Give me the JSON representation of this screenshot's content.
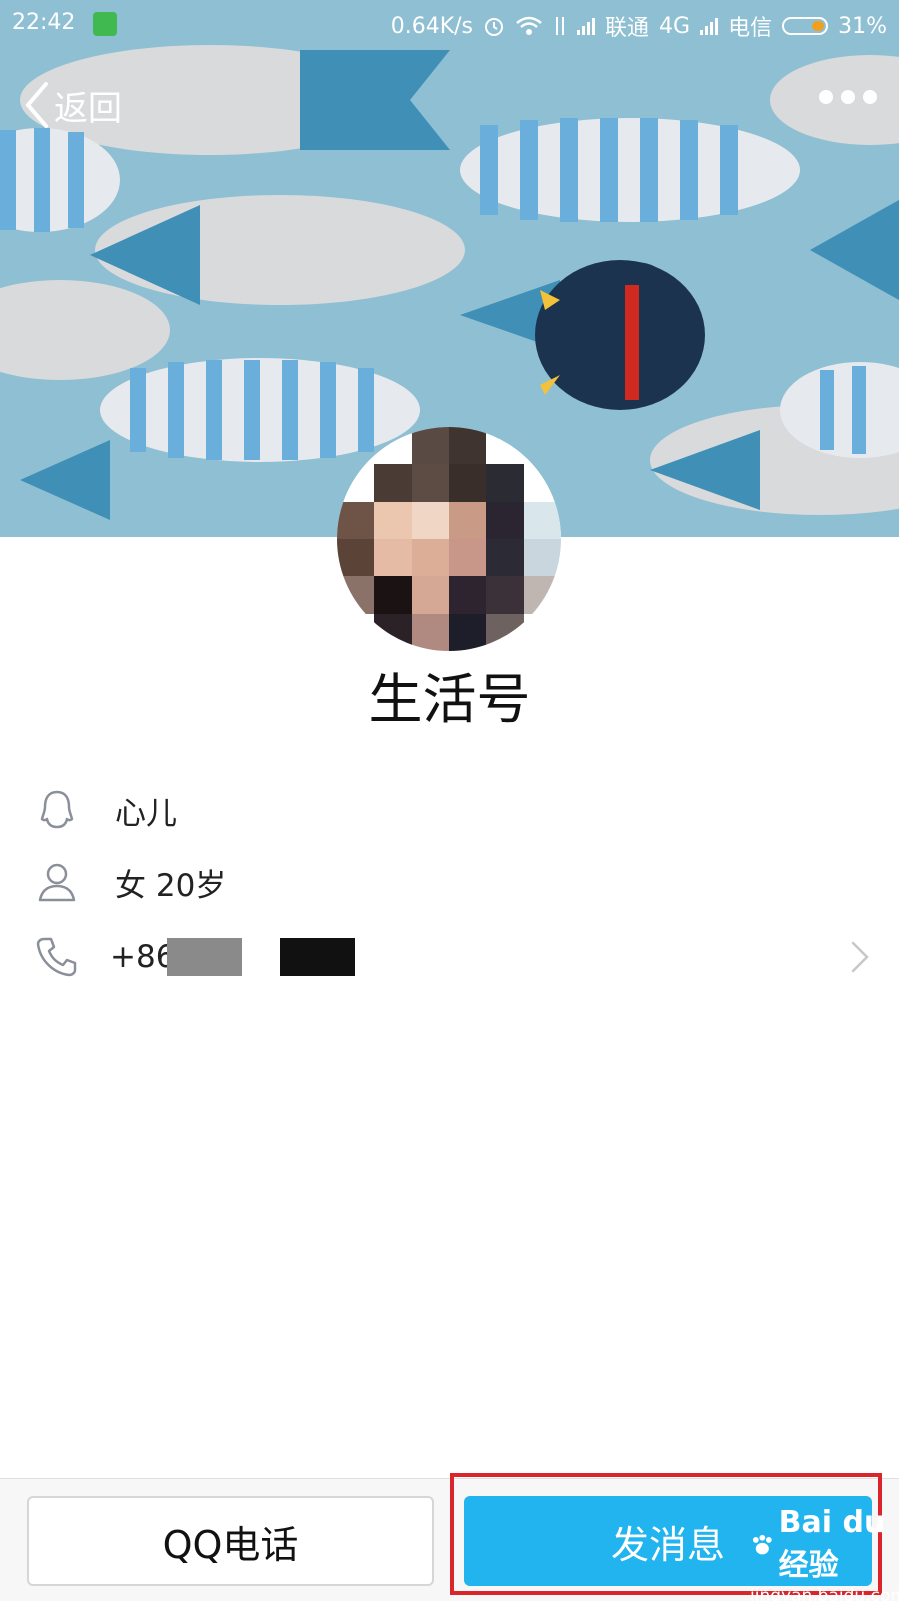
{
  "status_bar": {
    "time": "22:42",
    "net_speed": "0.64K/s",
    "carrier1": "联通",
    "network_type": "4G",
    "carrier2": "电信",
    "battery": "31%"
  },
  "nav": {
    "back_label": "返回"
  },
  "profile": {
    "name": "生活号",
    "nickname": "心儿",
    "gender_age": "女  20岁",
    "phone_prefix": "+86"
  },
  "actions": {
    "call_label": "QQ电话",
    "message_label": "发消息"
  },
  "watermark": {
    "brand": "Bai du 经验",
    "url": "jingyan.baidu.com"
  },
  "colors": {
    "accent": "#21b4ee",
    "highlight": "#d9252b",
    "cover_bg": "#8fbfd2"
  }
}
